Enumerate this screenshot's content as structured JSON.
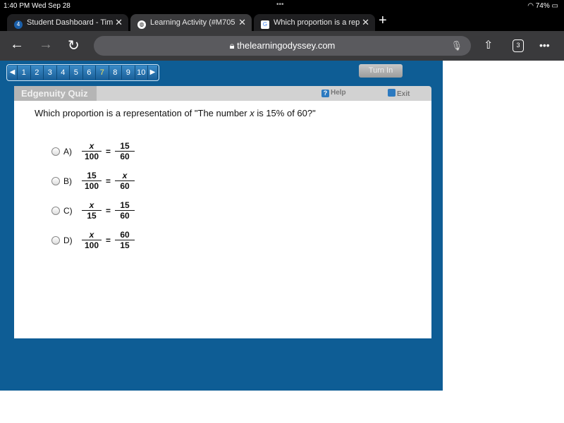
{
  "status": {
    "time": "1:40 PM  Wed Sep 28",
    "battery": "74%"
  },
  "tabs": [
    {
      "title": "Student Dashboard - Tim",
      "active": false
    },
    {
      "title": "Learning Activity (#M705",
      "active": true
    },
    {
      "title": "Which proportion is a rep",
      "active": false
    }
  ],
  "toolbar": {
    "url": "thelearningodyssey.com",
    "tab_count": "3"
  },
  "quiz": {
    "pages": [
      "1",
      "2",
      "3",
      "4",
      "5",
      "6",
      "7",
      "8",
      "9",
      "10"
    ],
    "current_page": "7",
    "turn_in": "Turn In",
    "title": "Edgenuity Quiz",
    "help": "Help",
    "exit": "Exit",
    "question_pre": "Which proportion is a representation of \"The number ",
    "question_var": "x",
    "question_post": " is 15% of 60?\"",
    "options": [
      {
        "label": "A)",
        "ln": "x",
        "ld": "100",
        "rn": "15",
        "rd": "60"
      },
      {
        "label": "B)",
        "ln": "15",
        "ld": "100",
        "rn": "x",
        "rd": "60"
      },
      {
        "label": "C)",
        "ln": "x",
        "ld": "15",
        "rn": "15",
        "rd": "60"
      },
      {
        "label": "D)",
        "ln": "x",
        "ld": "100",
        "rn": "60",
        "rd": "15"
      }
    ],
    "equals": "="
  }
}
